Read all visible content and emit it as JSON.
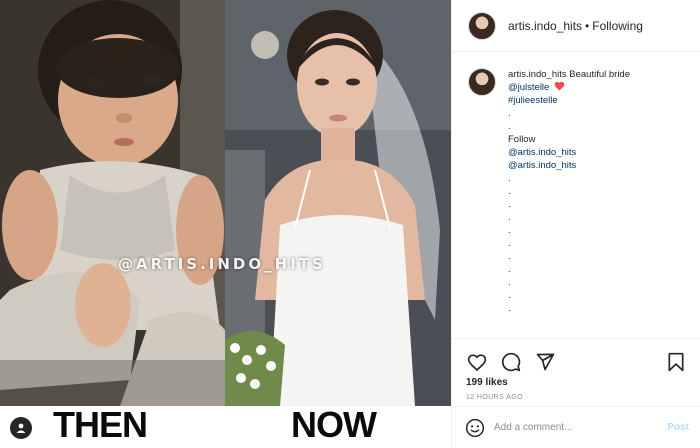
{
  "media": {
    "watermark": "@ARTIS.INDO_HITS",
    "label_left": "THEN",
    "label_right": "NOW",
    "tag_icon": "user-tag-icon"
  },
  "header": {
    "username": "artis.indo_hits",
    "separator": "•",
    "follow_status": "Following"
  },
  "caption": {
    "username": "artis.indo_hits",
    "text": "Beautiful bride",
    "mention": "@julstelle",
    "emoji": "red-heart-icon",
    "hashtag": "#julieestelle",
    "follow_label": "Follow",
    "follow_mentions": [
      "@artis.indo_hits",
      "@artis.indo_hits"
    ]
  },
  "actions": {
    "icons": [
      "heart-icon",
      "comment-icon",
      "share-icon",
      "bookmark-icon"
    ],
    "likes": "199 likes",
    "time": "12 HOURS AGO"
  },
  "comment": {
    "placeholder": "Add a comment...",
    "post_label": "Post"
  },
  "colors": {
    "link": "#00376b",
    "post_button": "#b2dffc",
    "heart": "#ed4956",
    "muted": "#8e8e8e"
  }
}
